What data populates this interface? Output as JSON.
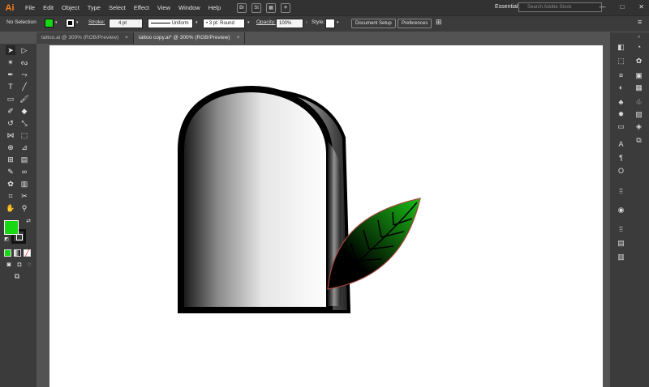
{
  "app": {
    "logo": "Ai"
  },
  "menu": [
    "File",
    "Edit",
    "Object",
    "Type",
    "Select",
    "Effect",
    "View",
    "Window",
    "Help"
  ],
  "menu_buttons": [
    "Br",
    "St"
  ],
  "workspace": {
    "label": "Essentials",
    "chevron": "⌄"
  },
  "search": {
    "placeholder": "Search Adobe Stock"
  },
  "window_controls": [
    "—",
    "□",
    "✕"
  ],
  "control_bar": {
    "selection_label": "No Selection",
    "stroke_label": "Stroke:",
    "stroke_value": "4 pt",
    "stroke_profile": "Uniform",
    "brush": "3 pt. Round",
    "opacity_label": "Opacity:",
    "opacity_value": "100%",
    "style_label": "Style:",
    "document_setup": "Document Setup",
    "preferences": "Preferences",
    "fill_color": "#18d814"
  },
  "tabs": [
    {
      "label": "tattoo.ai @ 300% (RGB/Preview)",
      "active": false,
      "close": "×"
    },
    {
      "label": "tattoo copy.ai* @ 300% (RGB/Preview)",
      "active": true,
      "close": "×"
    }
  ],
  "tools": [
    "selection-tool",
    "direct-selection-tool",
    "magic-wand-tool",
    "lasso-tool",
    "pen-tool",
    "curvature-tool",
    "type-tool",
    "line-tool",
    "rectangle-tool",
    "paintbrush-tool",
    "shaper-tool",
    "eraser-tool",
    "rotate-tool",
    "scale-tool",
    "width-tool",
    "free-transform-tool",
    "shape-builder-tool",
    "perspective-tool",
    "mesh-tool",
    "gradient-tool",
    "eyedropper-tool",
    "blend-tool",
    "symbol-sprayer-tool",
    "column-graph-tool",
    "artboard-tool",
    "slice-tool",
    "hand-tool",
    "zoom-tool"
  ],
  "colors": {
    "fill": "#18d814",
    "stroke": "#000000",
    "accent": "#ff7f18",
    "leaf": "#1bbf17"
  }
}
